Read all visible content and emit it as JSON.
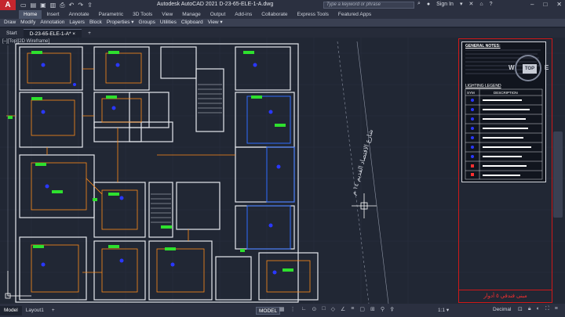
{
  "titlebar": {
    "app_name": "A",
    "window_title": "Autodesk AutoCAD 2021   D-23-65-ELE-1-A.dwg",
    "search_placeholder": "Type a keyword or phrase",
    "sign_in": "Sign In",
    "win_min": "–",
    "win_max": "□",
    "win_close": "✕",
    "qat_icons": [
      "new-icon",
      "open-icon",
      "save-icon",
      "save-as-icon",
      "plot-icon",
      "undo-icon",
      "redo-icon",
      "share-icon"
    ]
  },
  "ribbon": {
    "tabs": [
      "Home",
      "Insert",
      "Annotate",
      "Parametric",
      "3D Tools",
      "View",
      "Manage",
      "Output",
      "Add-ins",
      "Collaborate",
      "Express Tools",
      "Featured Apps"
    ],
    "active_tab": "Home",
    "panels": [
      "Draw",
      "Modify",
      "Annotation",
      "Layers",
      "Block",
      "Properties ▾",
      "Groups",
      "Utilities",
      "Clipboard",
      "View ▾"
    ]
  },
  "file_tabs": {
    "start": "Start",
    "active": "D-23-65-ELE-1-A*",
    "close": "×",
    "add": "+"
  },
  "viewport": {
    "label": "[–][Top][2D Wireframe]",
    "viewcube_top": "TOP",
    "compass_w": "W",
    "compass_e": "E",
    "street_label": "شارع الاقتصاد القديم ١٤ م",
    "legend": {
      "general_notes": "GENERAL NOTES:",
      "legend_heading": "LIGHTING LEGEND",
      "col_symbol": "SYM",
      "col_desc": "DESCRIPTION"
    },
    "title_block": "مبنى فندقي ٥ أدوار"
  },
  "status": {
    "tabs": [
      "Model",
      "Layout1"
    ],
    "active_tab": "Model",
    "add_layout": "+",
    "model_button": "MODEL",
    "scale": "1:1 ▾",
    "units": "Decimal"
  },
  "colors": {
    "accent_red": "#c4262e",
    "wall_white": "#e6e8ee",
    "fixture_green": "#2ee02e",
    "fixture_blue": "#2a38ff",
    "wire_orange": "#ff8c1a",
    "highlight_blue": "#2f6cff",
    "border_red": "#d01818",
    "grid": "#2a3140"
  }
}
